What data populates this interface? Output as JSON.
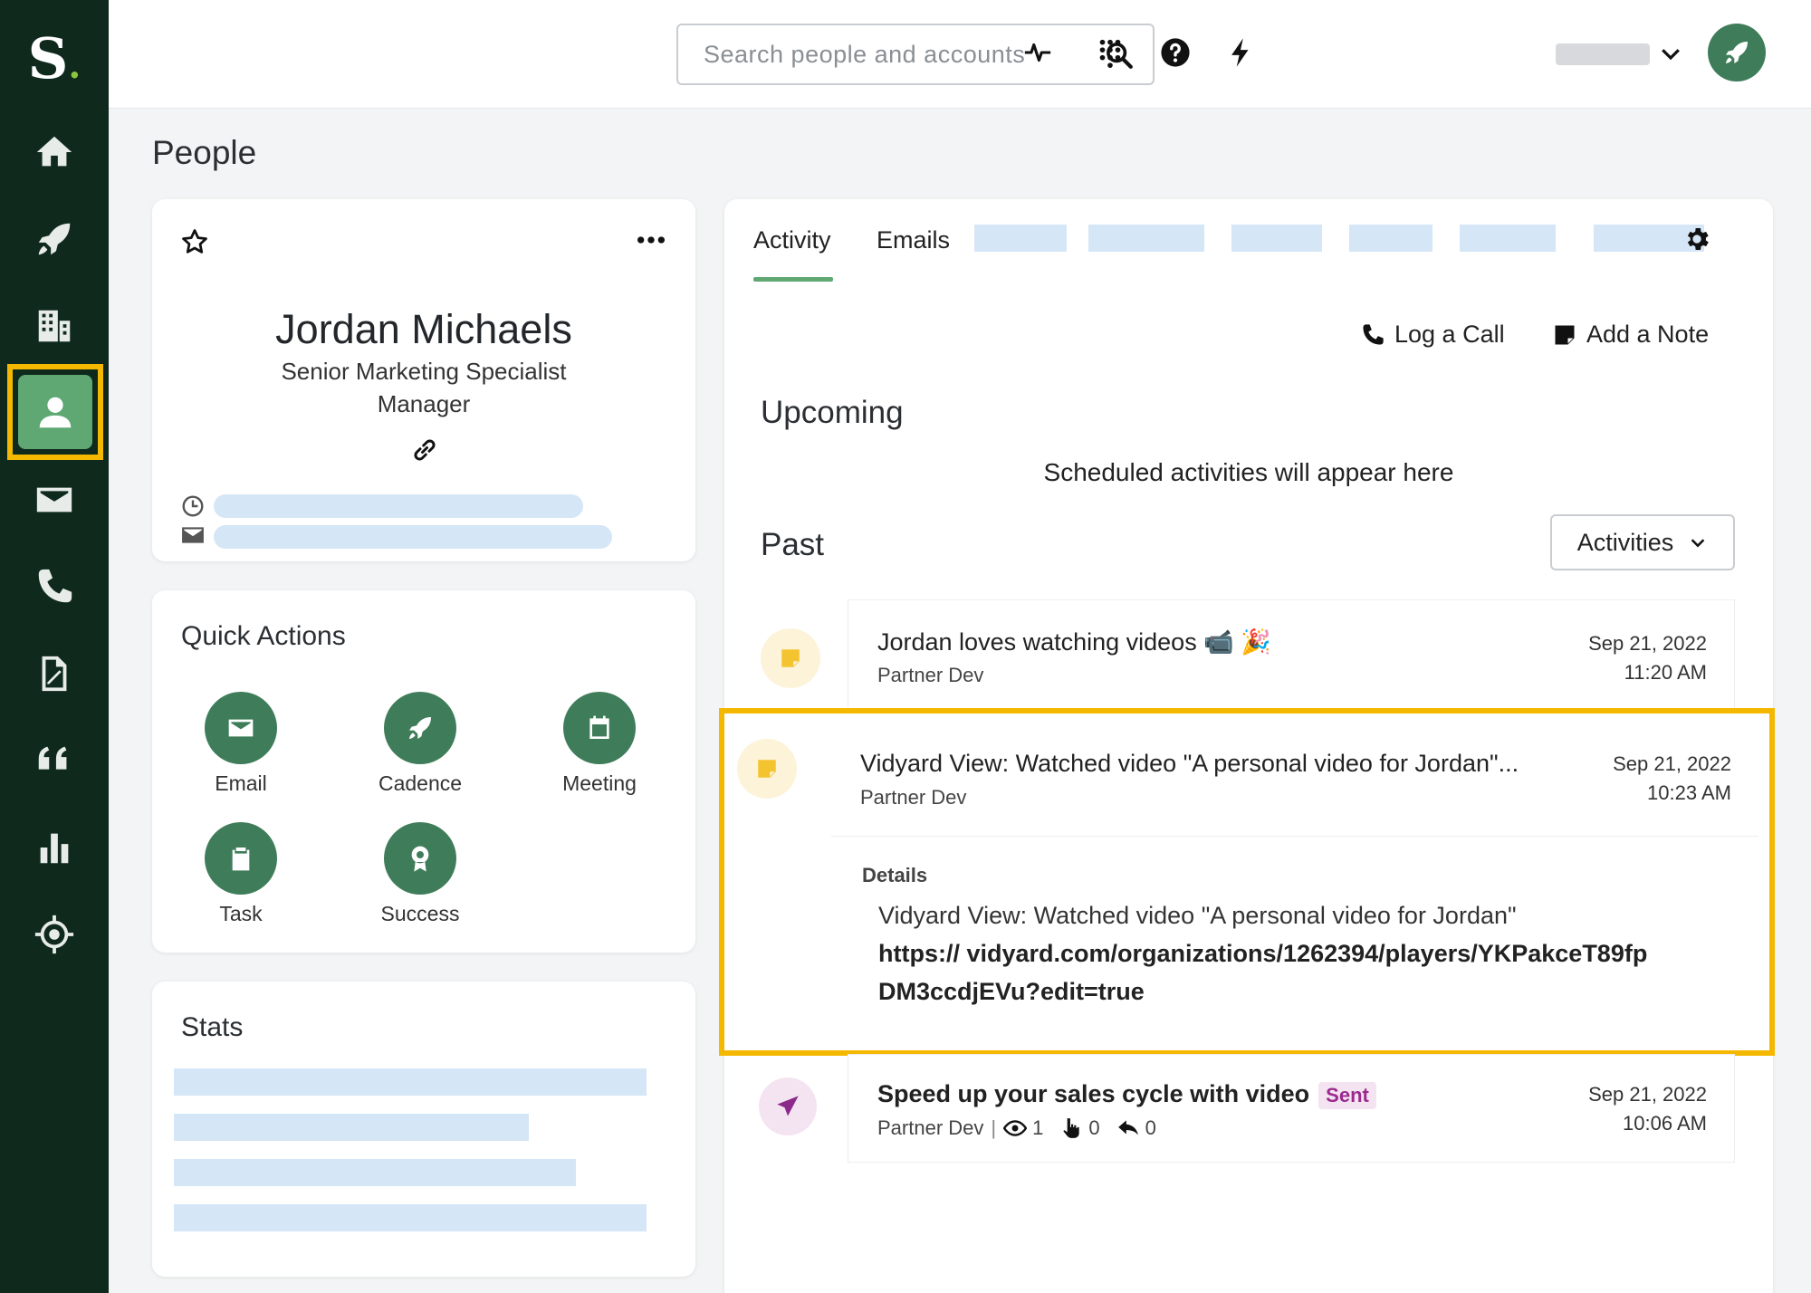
{
  "app": {
    "logo": "S",
    "logo_dot": "."
  },
  "nav": [
    {
      "name": "home",
      "icon": "home-icon"
    },
    {
      "name": "cadences",
      "icon": "rocket-icon"
    },
    {
      "name": "accounts",
      "icon": "building-icon"
    },
    {
      "name": "people",
      "icon": "person-icon",
      "active": true
    },
    {
      "name": "emails",
      "icon": "mail-icon"
    },
    {
      "name": "calls",
      "icon": "phone-icon"
    },
    {
      "name": "documents",
      "icon": "document-icon"
    },
    {
      "name": "quotes",
      "icon": "quote-icon"
    },
    {
      "name": "analytics",
      "icon": "bar-chart-icon"
    },
    {
      "name": "target",
      "icon": "crosshair-icon"
    }
  ],
  "search": {
    "placeholder": "Search people and accounts",
    "value": ""
  },
  "page": {
    "title": "People"
  },
  "profile": {
    "name": "Jordan Michaels",
    "title_line1": "Senior Marketing Specialist",
    "title_line2": "Manager"
  },
  "quick_actions": {
    "title": "Quick Actions",
    "items": [
      {
        "label": "Email",
        "icon": "mail-icon"
      },
      {
        "label": "Cadence",
        "icon": "rocket-icon"
      },
      {
        "label": "Meeting",
        "icon": "calendar-icon"
      },
      {
        "label": "Task",
        "icon": "clipboard-icon"
      },
      {
        "label": "Success",
        "icon": "ribbon-icon"
      }
    ]
  },
  "stats": {
    "title": "Stats"
  },
  "tabs": [
    {
      "label": "Activity",
      "active": true
    },
    {
      "label": "Emails",
      "active": false
    }
  ],
  "actions": {
    "log_call": "Log a Call",
    "add_note": "Add a Note"
  },
  "upcoming": {
    "heading": "Upcoming",
    "empty_text": "Scheduled activities will appear here"
  },
  "past": {
    "heading": "Past",
    "filter_label": "Activities"
  },
  "feed": [
    {
      "title": "Jordan loves watching videos 📹 🎉",
      "subtitle": "Partner Dev",
      "date": "Sep 21, 2022",
      "time": "11:20 AM",
      "icon": "note-icon"
    },
    {
      "title": "Vidyard View: Watched video \"A personal video for Jordan\"...",
      "subtitle": "Partner Dev",
      "date": "Sep 21, 2022",
      "time": "10:23 AM",
      "icon": "note-icon",
      "details_label": "Details",
      "details_text": "Vidyard View: Watched video \"A personal video for Jordan\"",
      "details_url": "https:// vidyard.com/organizations/1262394/players/YKPakceT89fpDM3ccdjEVu?edit=true"
    },
    {
      "title": "Speed up your sales cycle with video",
      "badge": "Sent",
      "subtitle": "Partner Dev",
      "separator": "|",
      "views": "1",
      "clicks": "0",
      "replies": "0",
      "date": "Sep 21, 2022",
      "time": "10:06 AM",
      "icon": "paper-plane-icon"
    }
  ],
  "colors": {
    "sidebar_bg": "#0f2a1c",
    "brand_green": "#3f7d5a",
    "active_green": "#5fa874",
    "highlight": "#f5b800",
    "skeleton": "#d5e6f6",
    "sent_badge": "#9b2a8f"
  }
}
